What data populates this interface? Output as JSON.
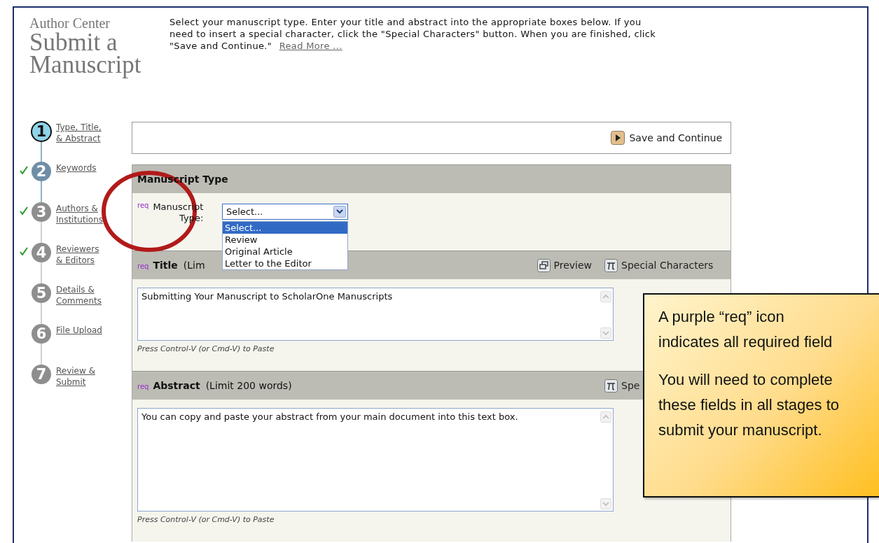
{
  "header": {
    "kicker": "Author Center",
    "title_lines": [
      "Submit a",
      "Manuscript"
    ]
  },
  "instructions": {
    "text_lines": [
      "Select your manuscript type. Enter your title and abstract into the appropriate boxes below. If you",
      "need to insert a special character, click the \"Special Characters\" button. When you are finished, click",
      "\"Save and Continue.\""
    ],
    "link": "Read More ..."
  },
  "steps": [
    {
      "number": "1",
      "label_lines": [
        "Type, Title,",
        "& Abstract"
      ],
      "current": true,
      "visited": true,
      "completed": false
    },
    {
      "number": "2",
      "label_lines": [
        "Keywords"
      ],
      "current": false,
      "visited": true,
      "completed": true
    },
    {
      "number": "3",
      "label_lines": [
        "Authors &",
        "Institutions"
      ],
      "current": false,
      "visited": false,
      "completed": true
    },
    {
      "number": "4",
      "label_lines": [
        "Reviewers",
        "& Editors"
      ],
      "current": false,
      "visited": false,
      "completed": true
    },
    {
      "number": "5",
      "label_lines": [
        "Details &",
        "Comments"
      ],
      "current": false,
      "visited": false,
      "completed": false
    },
    {
      "number": "6",
      "label_lines": [
        "File Upload"
      ],
      "current": false,
      "visited": false,
      "completed": false
    },
    {
      "number": "7",
      "label_lines": [
        "Review &",
        "Submit"
      ],
      "current": false,
      "visited": false,
      "completed": false
    }
  ],
  "save_bar": {
    "button": "Save and Continue"
  },
  "sections": [
    {
      "kind": "select",
      "title": "Manuscript Type",
      "field": {
        "required_mark": "req",
        "label_lines": [
          "Manuscript",
          "Type:"
        ],
        "value": "Select...",
        "expanded": true,
        "options": [
          {
            "label": "Select...",
            "selected": true
          },
          {
            "label": "Review",
            "selected": false
          },
          {
            "label": "Original Article",
            "selected": false
          },
          {
            "label": "Letter to the Editor",
            "selected": false
          }
        ]
      }
    },
    {
      "kind": "short-text",
      "required_mark": "req",
      "title": "Title",
      "note": "(Lim",
      "actions": [
        {
          "kind": "preview",
          "label": "Preview"
        },
        {
          "kind": "symbol",
          "label": "Special Characters"
        }
      ],
      "value": "Submitting Your Manuscript to ScholarOne Manuscripts",
      "hint": "Press Control-V (or Cmd-V) to Paste"
    },
    {
      "kind": "long-text",
      "required_mark": "req",
      "title": "Abstract",
      "note": "(Limit 200 words)",
      "actions": [
        {
          "kind": "symbol",
          "label": "Spe"
        }
      ],
      "value": "You can copy and paste your abstract from your main document into this text box.",
      "hint": "Press Control-V (or Cmd-V) to Paste"
    }
  ],
  "callout": {
    "paragraphs": [
      [
        "A purple “req” icon",
        "indicates all required field"
      ],
      [
        "You will need to complete",
        "these fields in all stages to",
        "submit your manuscript."
      ]
    ]
  }
}
